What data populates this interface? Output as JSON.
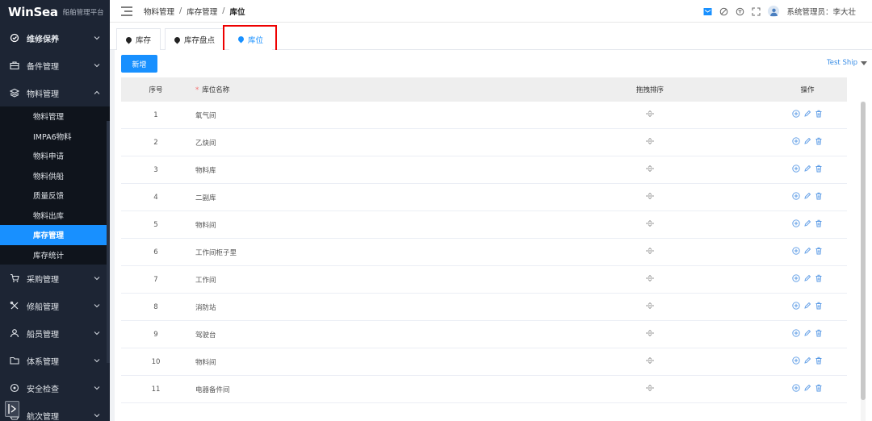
{
  "app": {
    "logo": "WinSea",
    "subtitle": "船舶管理平台"
  },
  "sidebar": {
    "items": [
      {
        "label": "维修保养",
        "icon": "gear-icon"
      },
      {
        "label": "备件管理",
        "icon": "briefcase-icon"
      },
      {
        "label": "物料管理",
        "icon": "layers-icon"
      }
    ],
    "sub_items": [
      {
        "label": "物料管理"
      },
      {
        "label": "IMPA6物料"
      },
      {
        "label": "物料申请"
      },
      {
        "label": "物料供船"
      },
      {
        "label": "质量反馈"
      },
      {
        "label": "物料出库"
      },
      {
        "label": "库存管理"
      },
      {
        "label": "库存统计"
      }
    ],
    "items2": [
      {
        "label": "采购管理",
        "icon": "cart-icon"
      },
      {
        "label": "修船管理",
        "icon": "tools-icon"
      },
      {
        "label": "船员管理",
        "icon": "people-icon"
      },
      {
        "label": "体系管理",
        "icon": "folder-icon"
      },
      {
        "label": "安全检查",
        "icon": "shield-icon"
      },
      {
        "label": "航次管理",
        "icon": "voyage-icon"
      }
    ]
  },
  "breadcrumb": {
    "items": [
      "物料管理",
      "库存管理",
      "库位"
    ],
    "sep": "/"
  },
  "user": {
    "label": "系统管理员：李大壮"
  },
  "tabs": [
    {
      "label": "库存"
    },
    {
      "label": "库存盘点"
    },
    {
      "label": "库位"
    }
  ],
  "toolbar": {
    "new_label": "新增",
    "ship_select": "Test Ship"
  },
  "table": {
    "headers": {
      "index": "序号",
      "required_mark": "*",
      "name": "库位名称",
      "drag": "拖拽排序",
      "ops": "操作"
    },
    "rows": [
      {
        "index": "1",
        "name": "氧气间"
      },
      {
        "index": "2",
        "name": "乙炔间"
      },
      {
        "index": "3",
        "name": "物料库"
      },
      {
        "index": "4",
        "name": "二副库"
      },
      {
        "index": "5",
        "name": "物料间"
      },
      {
        "index": "6",
        "name": "工作间柜子里"
      },
      {
        "index": "7",
        "name": "工作间"
      },
      {
        "index": "8",
        "name": "消防站"
      },
      {
        "index": "9",
        "name": "驾驶台"
      },
      {
        "index": "10",
        "name": "物料间"
      },
      {
        "index": "11",
        "name": "电器备件间"
      }
    ]
  },
  "colors": {
    "accent": "#1890ff",
    "sidebar": "#1d2534",
    "highlight": "#e00000"
  }
}
